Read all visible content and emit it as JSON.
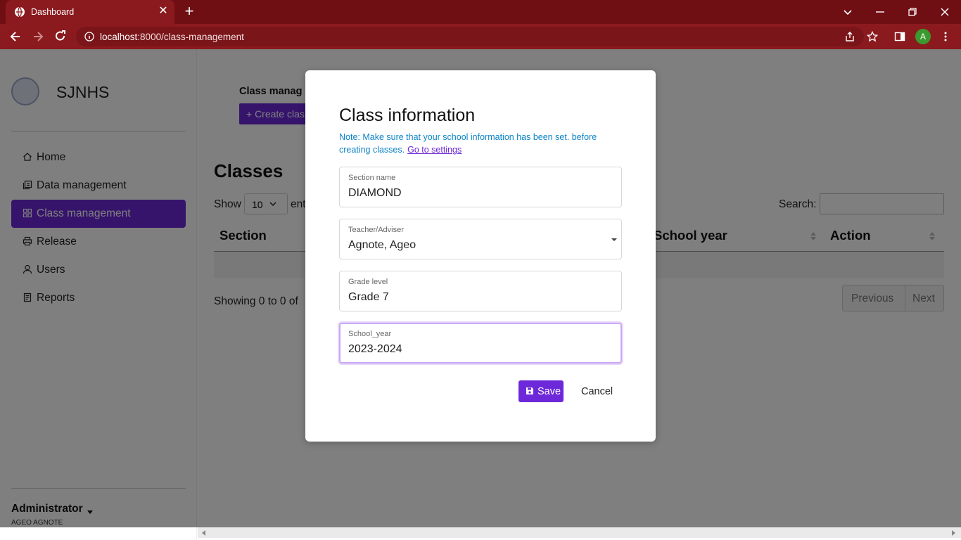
{
  "browser": {
    "tab_title": "Dashboard",
    "url_host": "localhost",
    "url_rest": ":8000/class-management",
    "profile_initial": "A"
  },
  "sidebar": {
    "brand": "SJNHS",
    "items": [
      {
        "label": "Home",
        "icon": "home-icon"
      },
      {
        "label": "Data management",
        "icon": "data-icon"
      },
      {
        "label": "Class management",
        "icon": "grid-icon",
        "active": true
      },
      {
        "label": "Release",
        "icon": "printer-icon"
      },
      {
        "label": "Users",
        "icon": "user-icon"
      },
      {
        "label": "Reports",
        "icon": "report-icon"
      }
    ],
    "user": {
      "name": "Administrator",
      "subtitle": "AGEO AGNOTE"
    }
  },
  "main": {
    "page_title": "Class manag",
    "create_button": "+ Create clas",
    "heading": "Classes",
    "show_label": "Show",
    "show_value": "10",
    "entries_label": "ent",
    "search_label": "Search:",
    "columns": [
      "Section",
      "School year",
      "Action"
    ],
    "showing_text": "Showing 0 to 0 of",
    "pager": {
      "previous": "Previous",
      "next": "Next"
    }
  },
  "modal": {
    "title": "Class information",
    "note": "Note: Make sure that your school information has been set. before creating classes.",
    "note_link": "Go to settings",
    "fields": [
      {
        "label": "Section name",
        "value": "DIAMOND"
      },
      {
        "label": "Teacher/Adviser",
        "value": "Agnote, Ageo"
      },
      {
        "label": "Grade level",
        "value": "Grade 7"
      },
      {
        "label": "School_year",
        "value": "2023-2024"
      }
    ],
    "save": "Save",
    "cancel": "Cancel"
  },
  "colors": {
    "browser_frame": "#6f0f13",
    "accent": "#6d28d9",
    "note": "#0d84c7"
  }
}
